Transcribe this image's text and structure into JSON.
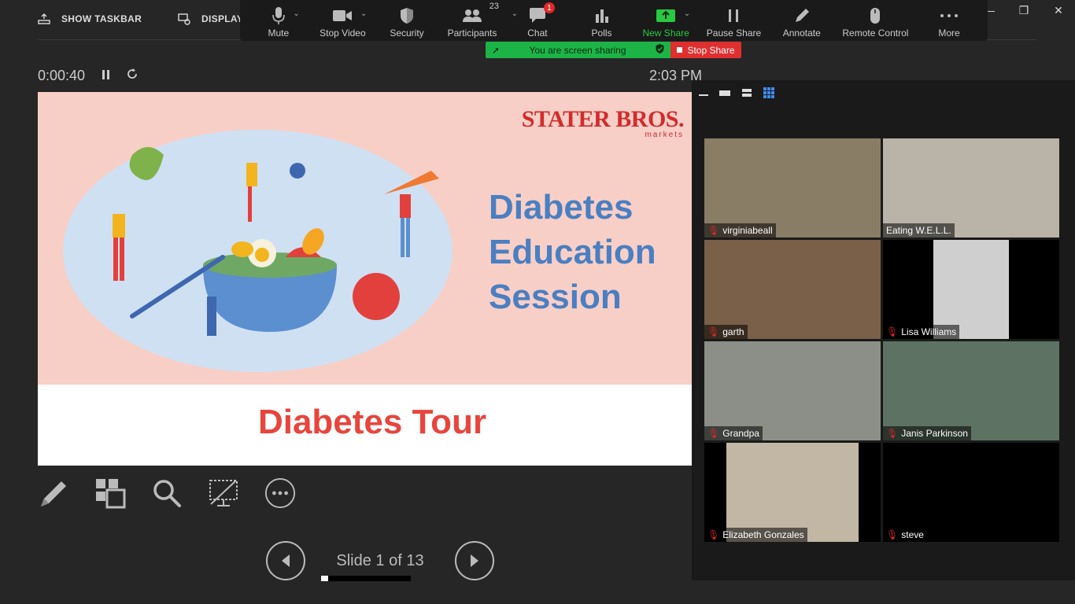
{
  "presenter_bar": {
    "show_taskbar": "SHOW TASKBAR",
    "display_settings": "DISPLAY S"
  },
  "toolbar": {
    "mute": "Mute",
    "stop_video": "Stop Video",
    "security": "Security",
    "participants": "Participants",
    "participants_count": "23",
    "chat": "Chat",
    "chat_badge": "1",
    "polls": "Polls",
    "new_share": "New Share",
    "pause_share": "Pause Share",
    "annotate": "Annotate",
    "remote_control": "Remote Control",
    "more": "More"
  },
  "share_banner": {
    "message": "You are screen sharing",
    "stop": "Stop Share"
  },
  "timer": {
    "elapsed": "0:00:40"
  },
  "clock": "2:03 PM",
  "slide": {
    "brand": "STATER BROS.",
    "brand_sub": "markets",
    "title_lines": [
      "Diabetes",
      "Education",
      "Session"
    ],
    "subtitle": "Diabetes Tour"
  },
  "navigation": {
    "slide_label": "Slide 1 of 13",
    "current": 1,
    "total": 13
  },
  "participants": [
    {
      "name": "virginiabeall",
      "bg": "#8a7d66"
    },
    {
      "name": "Eating W.E.L.L.",
      "bg": "#b9b3a8"
    },
    {
      "name": "garth",
      "bg": "#7a6048"
    },
    {
      "name": "Lisa Williams",
      "bg": "#cfcfcf"
    },
    {
      "name": "Grandpa",
      "bg": "#8b8f88"
    },
    {
      "name": "Janis Parkinson",
      "bg": "#5d7263"
    },
    {
      "name": "Elizabeth Gonzales",
      "bg": "#c2b6a4"
    },
    {
      "name": "steve",
      "bg": "#000000"
    }
  ],
  "colors": {
    "accent_green": "#28c840",
    "alert_red": "#e02828",
    "slide_blue": "#4a7fc1",
    "slide_red": "#e8453c"
  }
}
